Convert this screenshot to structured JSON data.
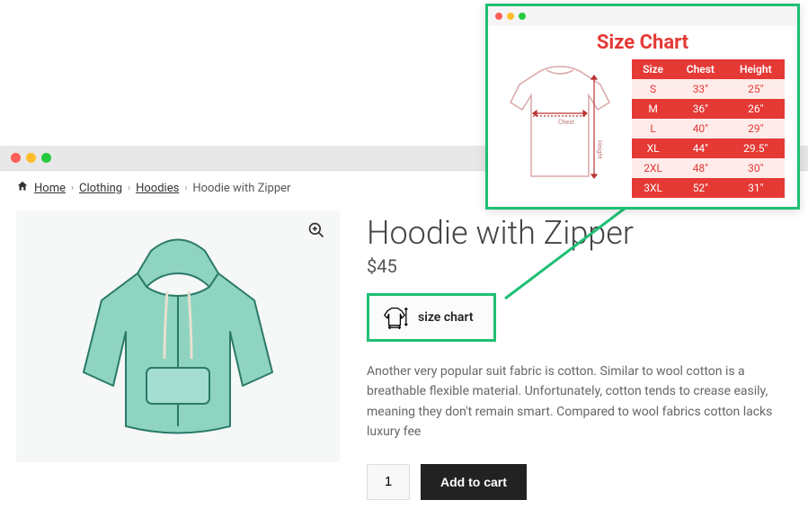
{
  "breadcrumb": {
    "home": "Home",
    "clothing": "Clothing",
    "hoodies": "Hoodies",
    "current": "Hoodie with Zipper"
  },
  "product": {
    "title": "Hoodie with Zipper",
    "price": "$45",
    "size_chart_label": "size chart",
    "description": "Another very popular suit fabric is cotton. Similar to wool cotton is a breathable flexible material. Unfortunately, cotton tends to crease easily, meaning they don't remain smart. Compared to wool fabrics cotton lacks luxury fee",
    "qty": "1",
    "add_to_cart_label": "Add to cart"
  },
  "popup": {
    "title": "Size Chart",
    "diagram_chest": "Chest",
    "diagram_height": "Height",
    "headers": {
      "size": "Size",
      "chest": "Chest",
      "height": "Height"
    },
    "rows": [
      {
        "size": "S",
        "chest": "33\"",
        "height": "25\""
      },
      {
        "size": "M",
        "chest": "36\"",
        "height": "26\""
      },
      {
        "size": "L",
        "chest": "40\"",
        "height": "29\""
      },
      {
        "size": "XL",
        "chest": "44\"",
        "height": "29.5\""
      },
      {
        "size": "2XL",
        "chest": "48\"",
        "height": "30\""
      },
      {
        "size": "3XL",
        "chest": "52\"",
        "height": "31\""
      }
    ]
  }
}
